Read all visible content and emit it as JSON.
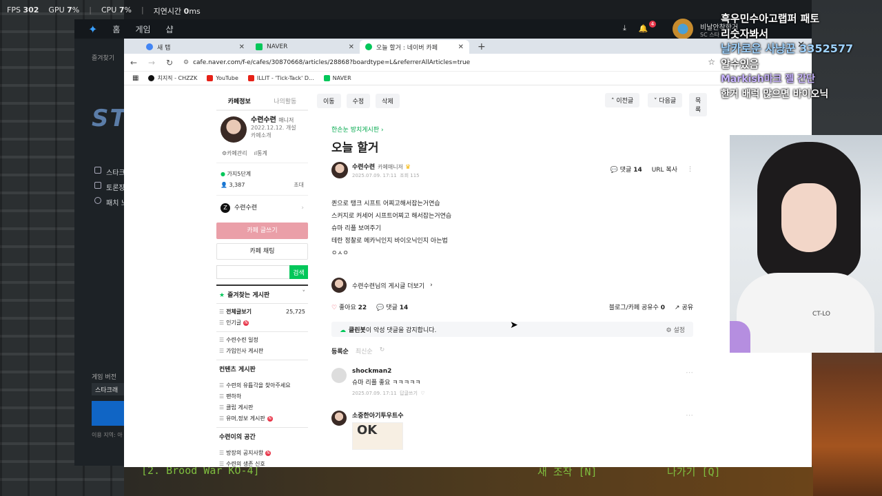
{
  "perf": {
    "fps_label": "FPS",
    "fps": "302",
    "gpu_label": "GPU",
    "gpu": "7",
    "cpu_label": "CPU",
    "cpu": "7",
    "latency_label": "지연시간",
    "latency": "0",
    "pct_unit": "%",
    "ms_unit": "ms"
  },
  "launcher": {
    "nav": [
      "홈",
      "게임",
      "샵"
    ],
    "side": [
      "즐겨찾기",
      "스타크",
      "토론장",
      "패치 노"
    ],
    "logo": "STA",
    "game_version_label": "게임 버전",
    "game_version_value": "스타크래",
    "region_label": "이용 지역: 아",
    "user_name": "비날안착한거",
    "user_sub": "SC 스타",
    "notif_count": "4"
  },
  "browser": {
    "tabs": [
      {
        "title": "새 탭",
        "fav_color": "#4285f4"
      },
      {
        "title": "NAVER",
        "fav_color": "#03c75a"
      },
      {
        "title": "오늘 할거 : 네이버 카페",
        "fav_color": "#03c75a"
      }
    ],
    "url": "cafe.naver.com/f-e/cafes/30870668/articles/28868?boardtype=L&referrerAllArticles=true",
    "bookmarks": [
      {
        "label": "치지직 - CHZZK",
        "color": "#111"
      },
      {
        "label": "YouTube",
        "color": "#e62117"
      },
      {
        "label": "ILLIT - 'Tick-Tack' D...",
        "color": "#e62117"
      },
      {
        "label": "NAVER",
        "color": "#03c75a"
      }
    ]
  },
  "cafe_side": {
    "tab_info": "카페정보",
    "tab_my": "나의활동",
    "manager_name": "수련수련",
    "manager_role": "매니저",
    "since": "2022.12.12. 개설",
    "intro": "카페소개",
    "link_manage": "카페관리",
    "link_stats": "통계",
    "level": "가지5단계",
    "members": "3,387",
    "invite": "초대",
    "member_name": "수련수련",
    "write_btn": "카페 글쓰기",
    "chat_btn": "카페 채팅",
    "search_btn": "검색",
    "fav_title": "즐겨찾는 게시판",
    "boards_1": [
      {
        "label": "전체글보기",
        "count": "25,725",
        "bold": true
      },
      {
        "label": "인기글",
        "new": true
      }
    ],
    "boards_2": [
      {
        "label": "수련수련 일정"
      },
      {
        "label": "가입인사 게시판"
      }
    ],
    "group_contents": "컨텐츠 게시판",
    "boards_3": [
      {
        "label": "수련의 유튭각을 찾아주세요"
      },
      {
        "label": "팬하하"
      },
      {
        "label": "클립 게시판"
      },
      {
        "label": "유머,정보 게시판",
        "new": true
      }
    ],
    "group_space": "수련이의 공간",
    "boards_4": [
      {
        "label": "방장의 공지사항",
        "new": true
      },
      {
        "label": "수련의 생존 신호"
      }
    ]
  },
  "article": {
    "toolbar_left": [
      "이동",
      "수정",
      "삭제"
    ],
    "prev": "이전글",
    "next": "다음글",
    "list": "목록",
    "board": "한손눈 방치게시판",
    "title": "오늘 할거",
    "author": "수련수련",
    "author_role": "카페매니저",
    "date": "2025.07.09. 17:11",
    "views": "조회 115",
    "comments_label": "댓글",
    "comments_count": "14",
    "url_copy": "URL 복사",
    "lines": [
      "퀸으로 탱크 시프트 어찌고해서잡는거연습",
      "스커지로 커세어 시프트어찌고 해서잡는거연습",
      "슈마 리플 보여주기",
      "테란 정찰로 메카닉인지 바이오닉인지 아는법",
      "ㅇㅅㅇ"
    ],
    "more_by": "수련수련님의 게시글 더보기",
    "like_label": "좋아요",
    "like_count": "22",
    "reply_label": "댓글",
    "reply_count": "14",
    "share_count_label": "블로그/카페 공유수",
    "share_count": "0",
    "share": "공유",
    "cleanbot_name": "클린봇",
    "cleanbot_text": "이 악성 댓글을 감지합니다.",
    "cleanbot_setting": "설정",
    "sort_reg": "등록순",
    "sort_new": "최신순",
    "comments": [
      {
        "name": "shockman2",
        "text": "슈마 리플 좋요 ㅋㅋㅋㅋㅋ",
        "date": "2025.07.09. 17:11",
        "reply": "답글쓰기"
      },
      {
        "name": "소중한아기투우트수",
        "sticker": "OK"
      }
    ]
  },
  "stream": {
    "chat": [
      {
        "text": "흑우민수아고랩퍼 패토",
        "style": "normal"
      },
      {
        "text": "리숫자봐서",
        "style": "normal"
      },
      {
        "text": "날카로운 사냥꾼 3352577",
        "style": "blue"
      },
      {
        "text": "알수있음",
        "style": "normal"
      },
      {
        "text": "Markish마크 젤 간단",
        "style": "purple"
      },
      {
        "text": "한거 배럭 많으면 바이오닉",
        "style": "normal"
      }
    ],
    "shirt_text": "CT-LO",
    "bottom_left": "[2. Brood War KO-4]",
    "bottom_mid": "새 조작 [N]",
    "bottom_right": "나가기 [Q]"
  },
  "colors": {
    "naver_green": "#03c75a",
    "write_button": "#ea9fa8",
    "launcher_blue": "#1065c5"
  }
}
